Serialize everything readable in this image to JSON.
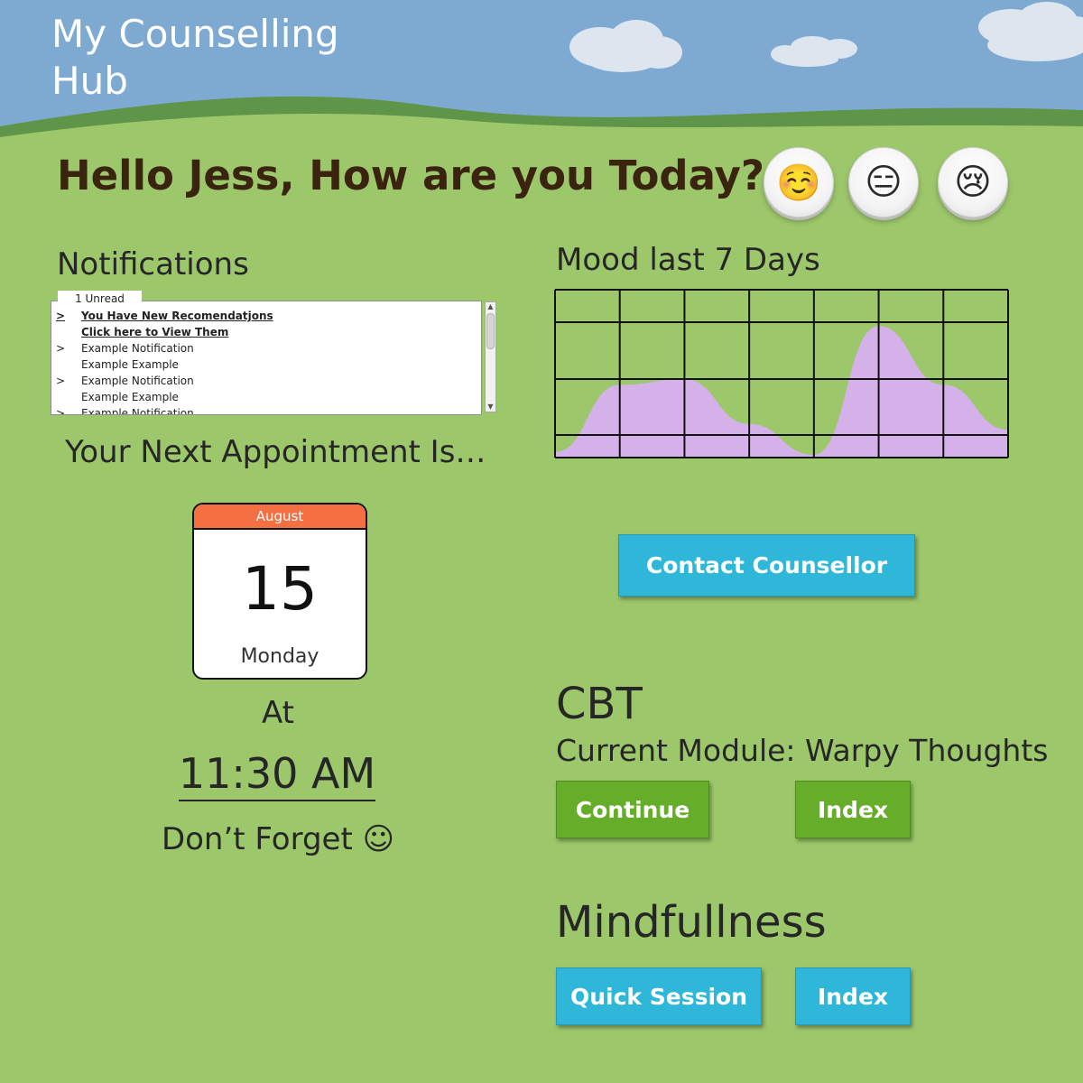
{
  "app": {
    "title": "My Counselling Hub"
  },
  "greeting": "Hello Jess, How are you Today?",
  "mood_buttons": [
    {
      "icon": "smiling-face-icon",
      "glyph": "☺️"
    },
    {
      "icon": "neutral-face-icon",
      "glyph": "😑"
    },
    {
      "icon": "crying-face-icon",
      "glyph": "😢"
    }
  ],
  "notifications": {
    "heading": "Notifications",
    "tab_label": "1 Unread",
    "items": [
      {
        "arrow": ">",
        "text": "You Have New Recomendatjons"
      },
      {
        "arrow": "",
        "text": "Click here to View Them"
      },
      {
        "arrow": ">",
        "text": "Example Notification"
      },
      {
        "arrow": "",
        "text": "Example Example"
      },
      {
        "arrow": ">",
        "text": "Example Notification"
      },
      {
        "arrow": "",
        "text": "Example Example"
      },
      {
        "arrow": ">",
        "text": "Example Notification"
      }
    ]
  },
  "appointment": {
    "heading": "Your Next Appointment Is…",
    "month": "August",
    "day": "15",
    "weekday": "Monday",
    "at_label": "At",
    "time": "11:30 AM",
    "reminder": "Don’t Forget ☺"
  },
  "mood_chart": {
    "heading": "Mood last 7 Days"
  },
  "chart_data": {
    "type": "area",
    "title": "Mood last 7 Days",
    "x": [
      0,
      1,
      2,
      3,
      4,
      5,
      6,
      7
    ],
    "values": [
      0.1,
      1.3,
      1.4,
      0.6,
      0.05,
      2.35,
      1.3,
      0.5
    ],
    "ylim": [
      0,
      3
    ],
    "grid": true,
    "fill_color": "#d5b1ea"
  },
  "contact_button": "Contact Counsellor",
  "cbt": {
    "heading": "CBT",
    "module_text": "Current Module: Warpy Thoughts",
    "continue_label": "Continue",
    "index_label": "Index"
  },
  "mindfulness": {
    "heading": "Mindfullness",
    "quick_label": "Quick Session",
    "index_label": "Index"
  },
  "colors": {
    "sky": "#7eaad2",
    "grass": "#9dc76b",
    "dark_grass": "#5f9548",
    "button_blue": "#2fb7d9",
    "button_green": "#66ad2a",
    "calendar_header": "#f46f42"
  }
}
